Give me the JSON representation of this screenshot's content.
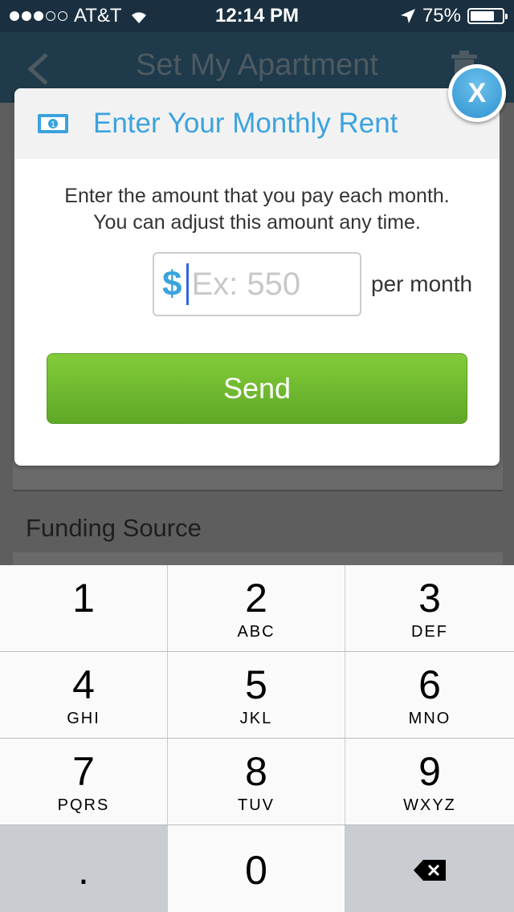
{
  "status_bar": {
    "carrier": "AT&T",
    "time": "12:14 PM",
    "battery": "75%",
    "battery_level": 0.75
  },
  "nav": {
    "title": "Set My Apartment"
  },
  "background": {
    "funding_label": "Funding Source"
  },
  "modal": {
    "title": "Enter Your Monthly Rent",
    "description_line1": "Enter the amount that you pay each month.",
    "description_line2": "You can adjust this amount any time.",
    "currency_symbol": "$",
    "amount_placeholder": "Ex: 550",
    "amount_value": "",
    "unit_label": "per month",
    "send_label": "Send",
    "close_label": "X"
  },
  "keypad": {
    "keys": [
      {
        "num": "1",
        "letters": ""
      },
      {
        "num": "2",
        "letters": "ABC"
      },
      {
        "num": "3",
        "letters": "DEF"
      },
      {
        "num": "4",
        "letters": "GHI"
      },
      {
        "num": "5",
        "letters": "JKL"
      },
      {
        "num": "6",
        "letters": "MNO"
      },
      {
        "num": "7",
        "letters": "PQRS"
      },
      {
        "num": "8",
        "letters": "TUV"
      },
      {
        "num": "9",
        "letters": "WXYZ"
      }
    ],
    "decimal": ".",
    "zero": "0"
  },
  "colors": {
    "accent": "#3ba3de",
    "send_green": "#6fbb2f"
  }
}
